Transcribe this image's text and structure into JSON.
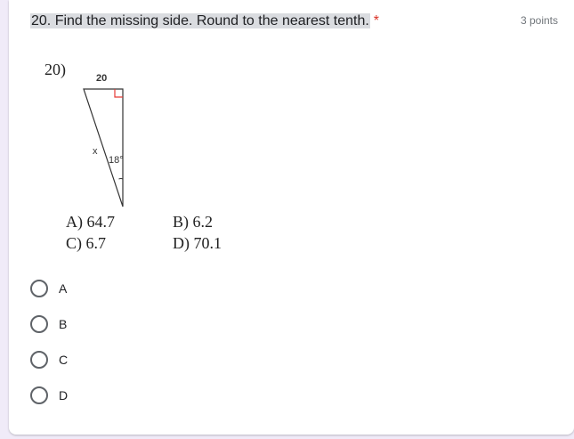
{
  "question": {
    "title": "20. Find the missing side. Round to the nearest tenth.",
    "required_marker": "*",
    "points": "3 points"
  },
  "figure": {
    "problem_number": "20)",
    "top_side_label": "20",
    "unknown_side_label": "x",
    "angle_label": "18°",
    "choices": {
      "a": "A)  64.7",
      "b": "B)  6.2",
      "c": "C)  6.7",
      "d": "D)  70.1"
    },
    "colors": {
      "right_angle_marker": "#e53935"
    }
  },
  "options": [
    {
      "label": "A"
    },
    {
      "label": "B"
    },
    {
      "label": "C"
    },
    {
      "label": "D"
    }
  ]
}
